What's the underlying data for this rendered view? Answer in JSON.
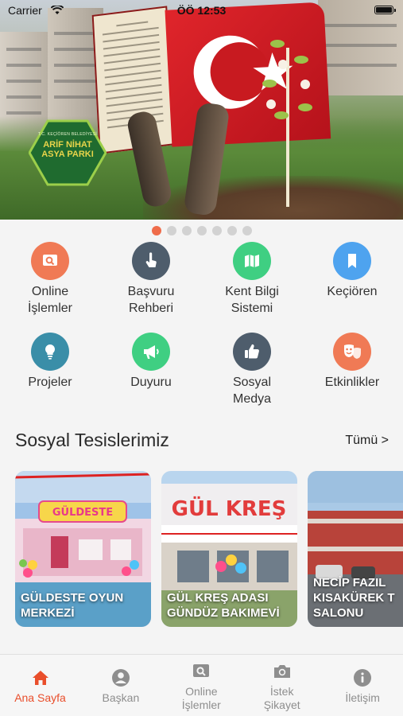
{
  "status_bar": {
    "carrier": "Carrier",
    "time": "ÖÖ 12:53"
  },
  "banner": {
    "badge_small": "T.C. KEÇİÖREN BELEDİYESİ",
    "badge_name": "ARİF NİHAT ASYA PARKI",
    "slide_count": 7,
    "active_slide": 1
  },
  "quick_links": [
    {
      "label": "Online\nİşlemler",
      "icon": "search-icon",
      "color": "#f07a55"
    },
    {
      "label": "Başvuru\nRehberi",
      "icon": "hand-pointer-icon",
      "color": "#4e5d6c"
    },
    {
      "label": "Kent Bilgi\nSistemi",
      "icon": "map-icon",
      "color": "#3fcf82"
    },
    {
      "label": "Keçiören",
      "icon": "bookmark-icon",
      "color": "#4ea3ef"
    },
    {
      "label": "Projeler",
      "icon": "lightbulb-icon",
      "color": "#3a8ea8"
    },
    {
      "label": "Duyuru",
      "icon": "megaphone-icon",
      "color": "#3fcf82"
    },
    {
      "label": "Sosyal\nMedya",
      "icon": "thumbs-up-icon",
      "color": "#4e5d6c"
    },
    {
      "label": "Etkinlikler",
      "icon": "theater-masks-icon",
      "color": "#f07a55"
    }
  ],
  "section": {
    "title": "Sosyal Tesislerimiz",
    "see_all": "Tümü >"
  },
  "facilities": [
    {
      "title": "GÜLDESTE OYUN\nMERKEZİ",
      "sign": "GÜLDESTE"
    },
    {
      "title": "GÜL KREŞ ADASI\nGÜNDÜZ BAKIMEVİ",
      "sign": "GÜL KREŞ"
    },
    {
      "title": "NECİP FAZIL\nKISAKÜREK T\nSALONU"
    }
  ],
  "tabs": [
    {
      "label": "Ana Sayfa",
      "icon": "home-icon",
      "active": true
    },
    {
      "label": "Başkan",
      "icon": "user-circle-icon",
      "active": false
    },
    {
      "label": "Online\nİşlemler",
      "icon": "search-icon",
      "active": false
    },
    {
      "label": "İstek\nŞikayet",
      "icon": "camera-icon",
      "active": false
    },
    {
      "label": "İletişim",
      "icon": "info-icon",
      "active": false
    }
  ],
  "colors": {
    "accent": "#e94e2b",
    "tab_inactive": "#8e8e8e"
  }
}
